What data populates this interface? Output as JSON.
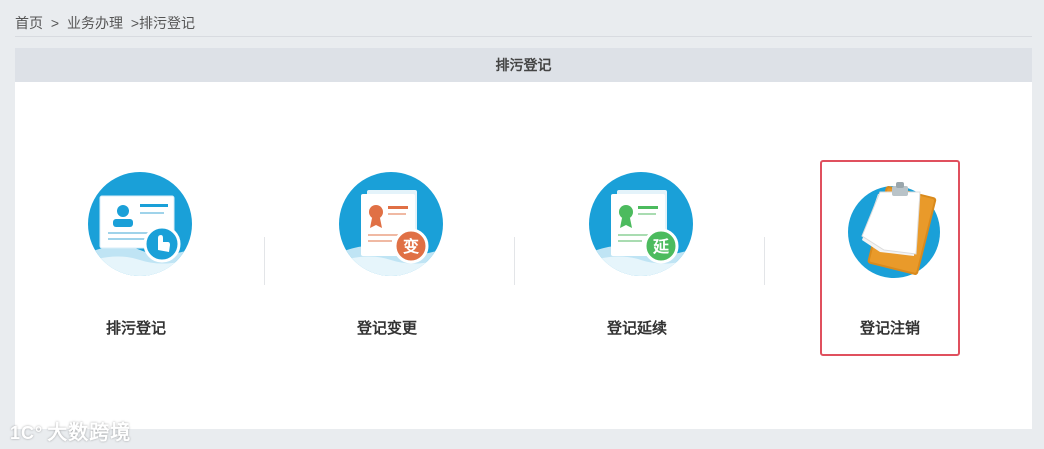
{
  "breadcrumb": {
    "home": "首页",
    "sep1": ">",
    "level1": "业务办理",
    "sep2": ">",
    "current": "排污登记"
  },
  "panel": {
    "title": "排污登记"
  },
  "items": [
    {
      "label": "排污登记",
      "icon": "registration-card-icon",
      "selected": false
    },
    {
      "label": "登记变更",
      "icon": "certificate-change-icon",
      "badge": "变",
      "badge_color": "#e07045",
      "selected": false
    },
    {
      "label": "登记延续",
      "icon": "certificate-extend-icon",
      "badge": "延",
      "badge_color": "#4cbb5e",
      "selected": false
    },
    {
      "label": "登记注销",
      "icon": "clipboard-cancel-icon",
      "selected": true
    }
  ],
  "colors": {
    "accent_blue": "#1aa0d8",
    "selected_border": "#e0505e",
    "header_bg": "#dde1e7"
  },
  "watermark": {
    "logo": "1C°",
    "text": "大数跨境"
  }
}
